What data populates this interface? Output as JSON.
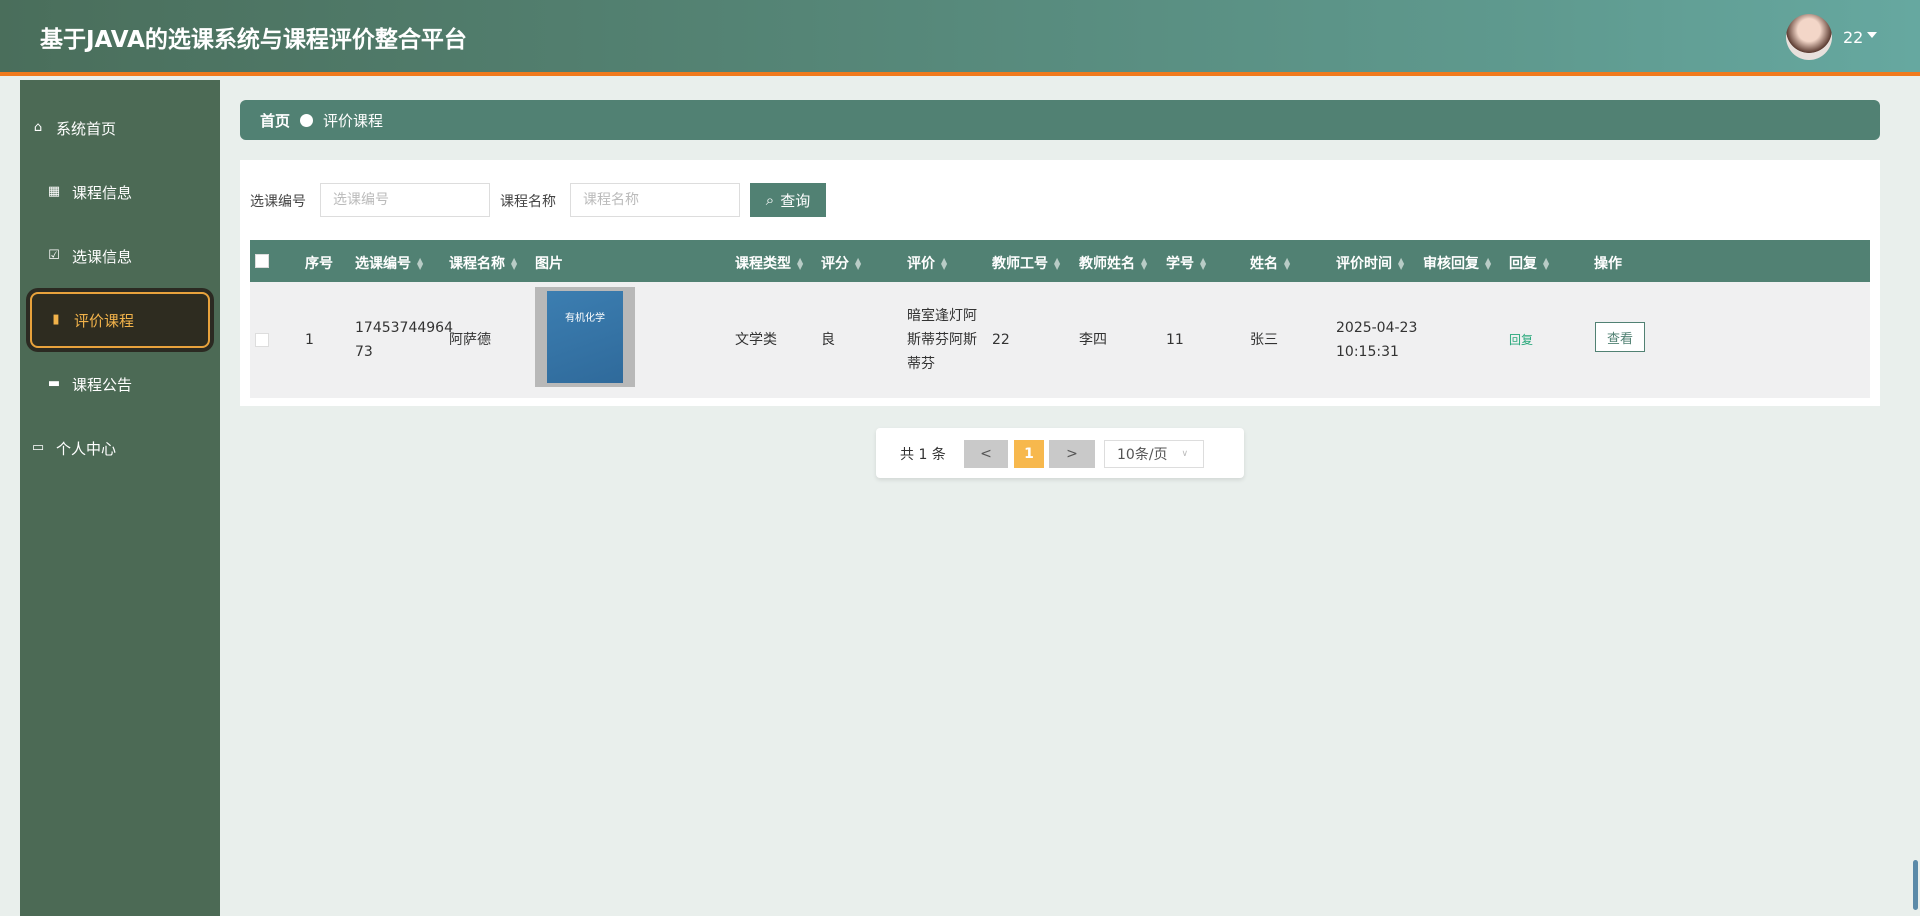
{
  "header": {
    "title": "基于JAVA的选课系统与课程评价整合平台",
    "username": "22"
  },
  "sidebar": {
    "items": [
      {
        "label": "系统首页",
        "icon": "home-icon"
      },
      {
        "label": "课程信息",
        "icon": "grid-icon"
      },
      {
        "label": "选课信息",
        "icon": "clipboard-check-icon"
      },
      {
        "label": "评价课程",
        "icon": "bar-chart-icon",
        "active": true
      },
      {
        "label": "课程公告",
        "icon": "monitor-icon"
      },
      {
        "label": "个人中心",
        "icon": "wallet-icon"
      }
    ]
  },
  "breadcrumb": {
    "home": "首页",
    "current": "评价课程"
  },
  "search": {
    "field1_label": "选课编号",
    "field1_placeholder": "选课编号",
    "field1_value": "",
    "field2_label": "课程名称",
    "field2_placeholder": "课程名称",
    "field2_value": "",
    "button": "查询"
  },
  "table": {
    "columns": [
      "序号",
      "选课编号",
      "课程名称",
      "图片",
      "课程类型",
      "评分",
      "评价",
      "教师工号",
      "教师姓名",
      "学号",
      "姓名",
      "评价时间",
      "审核回复",
      "回复",
      "操作"
    ],
    "rows": [
      {
        "index": "1",
        "enroll_no_1": "17453744964",
        "enroll_no_2": "73",
        "course": "阿萨德",
        "image_text": "有机化学",
        "type": "文学类",
        "score": "良",
        "review_1": "暗室逢灯阿",
        "review_2": "斯蒂芬阿斯",
        "review_3": "蒂芬",
        "teacher_id": "22",
        "teacher_name": "李四",
        "student_no": "11",
        "name": "张三",
        "time_1": "2025-04-23",
        "time_2": "10:15:31",
        "audit_reply": "",
        "reply": "回复",
        "action": "查看"
      }
    ]
  },
  "pagination": {
    "total": "共 1 条",
    "prev": "<",
    "current": "1",
    "next": ">",
    "page_size": "10条/页"
  },
  "colors": {
    "header": "#4a6e5b",
    "accent": "#518173",
    "orange": "#f07a1d",
    "active_text": "#f1b24a"
  }
}
